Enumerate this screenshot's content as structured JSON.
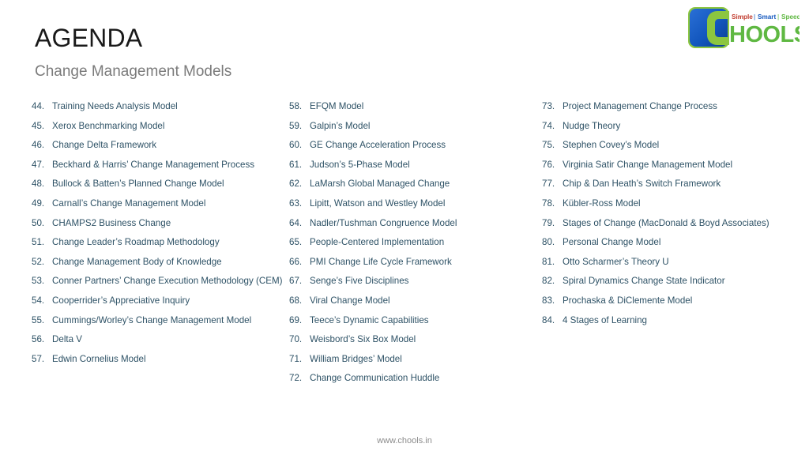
{
  "header": {
    "title": "AGENDA",
    "subtitle": "Change Management Models"
  },
  "logo": {
    "name": "chools-logo",
    "wordmark": "HOOLS",
    "tagline": [
      "Simple",
      "Smart",
      "Speed"
    ],
    "separator": "|",
    "colors": {
      "blue": "#1357be",
      "blue_dark": "#0e4aa0",
      "green": "#8cc63f",
      "green_text": "#5fb842",
      "tagline_red": "#c0392b",
      "tagline_blue": "#1357be",
      "tagline_green": "#5fb842"
    }
  },
  "theme": {
    "list_text": "#2e5266",
    "title_text": "#1a1a1a",
    "subtitle_text": "#7b7b7b",
    "footer_text": "#8c8c8c",
    "background": "#ffffff"
  },
  "columns": [
    {
      "id": "column-1",
      "items": [
        {
          "number": "44.",
          "label": "Training Needs Analysis Model"
        },
        {
          "number": "45.",
          "label": "Xerox Benchmarking Model"
        },
        {
          "number": "46.",
          "label": "Change Delta Framework"
        },
        {
          "number": "47.",
          "label": "Beckhard & Harris’ Change Management Process"
        },
        {
          "number": "48.",
          "label": "Bullock & Batten’s Planned Change Model"
        },
        {
          "number": "49.",
          "label": "Carnall’s Change Management Model"
        },
        {
          "number": "50.",
          "label": "CHAMPS2 Business Change"
        },
        {
          "number": "51.",
          "label": "Change Leader’s Roadmap Methodology"
        },
        {
          "number": "52.",
          "label": "Change Management Body of Knowledge"
        },
        {
          "number": "53.",
          "label": "Conner Partners’ Change Execution Methodology (CEM)"
        },
        {
          "number": "54.",
          "label": "Cooperrider’s Appreciative Inquiry"
        },
        {
          "number": "55.",
          "label": "Cummings/Worley’s Change Management Model"
        },
        {
          "number": "56.",
          "label": "Delta V"
        },
        {
          "number": "57.",
          "label": "Edwin Cornelius Model"
        }
      ]
    },
    {
      "id": "column-2",
      "items": [
        {
          "number": "58.",
          "label": "EFQM Model"
        },
        {
          "number": "59.",
          "label": "Galpin’s Model"
        },
        {
          "number": "60.",
          "label": "GE Change Acceleration Process"
        },
        {
          "number": "61.",
          "label": "Judson’s 5-Phase Model"
        },
        {
          "number": "62.",
          "label": "LaMarsh Global Managed Change"
        },
        {
          "number": "63.",
          "label": "Lipitt, Watson and Westley Model"
        },
        {
          "number": "64.",
          "label": "Nadler/Tushman Congruence Model"
        },
        {
          "number": "65.",
          "label": "People-Centered Implementation"
        },
        {
          "number": "66.",
          "label": "PMI Change Life Cycle Framework"
        },
        {
          "number": "67.",
          "label": "Senge’s Five Disciplines"
        },
        {
          "number": "68.",
          "label": "Viral Change Model"
        },
        {
          "number": "69.",
          "label": "Teece’s Dynamic Capabilities"
        },
        {
          "number": "70.",
          "label": "Weisbord’s Six Box Model"
        },
        {
          "number": "71.",
          "label": "William Bridges’ Model"
        },
        {
          "number": "72.",
          "label": "Change Communication Huddle"
        }
      ]
    },
    {
      "id": "column-3",
      "items": [
        {
          "number": "73.",
          "label": "Project Management Change Process"
        },
        {
          "number": "74.",
          "label": "Nudge Theory"
        },
        {
          "number": "75.",
          "label": "Stephen Covey’s Model"
        },
        {
          "number": "76.",
          "label": "Virginia Satir Change Management Model"
        },
        {
          "number": "77.",
          "label": "Chip & Dan Heath’s Switch Framework"
        },
        {
          "number": "78.",
          "label": "Kübler-Ross Model"
        },
        {
          "number": "79.",
          "label": "Stages of Change (MacDonald & Boyd Associates)"
        },
        {
          "number": "80.",
          "label": "Personal Change Model"
        },
        {
          "number": "81.",
          "label": "Otto Scharmer’s Theory U"
        },
        {
          "number": "82.",
          "label": "Spiral Dynamics Change State Indicator"
        },
        {
          "number": "83.",
          "label": "Prochaska & DiClemente Model"
        },
        {
          "number": "84.",
          "label": "4 Stages of Learning"
        }
      ]
    }
  ],
  "footer": {
    "url": "www.chools.in"
  }
}
